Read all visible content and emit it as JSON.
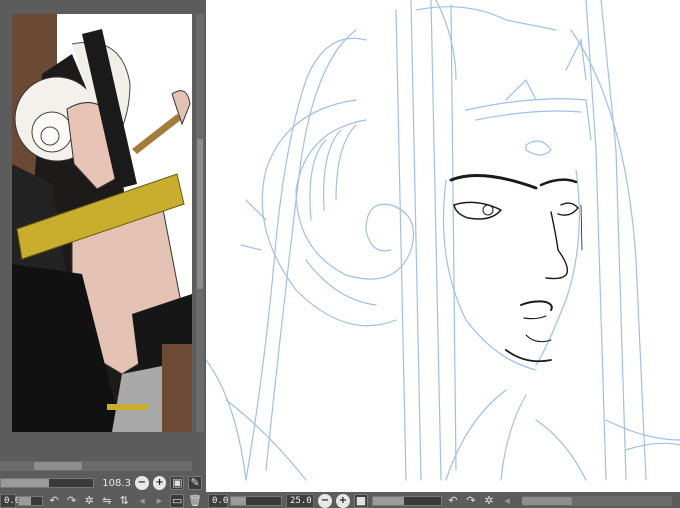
{
  "navigator": {
    "zoom_value": "108.3",
    "rotation_value": "0.0",
    "icons": [
      "zoom-out-icon",
      "zoom-in-icon",
      "fit-icon",
      "pen-icon",
      "rotate-left-icon",
      "rotate-right-icon",
      "reset-rotation-icon",
      "flip-horizontal-icon",
      "flip-vertical-icon"
    ]
  },
  "canvas_toolbar": {
    "rotation_value": "0.0",
    "zoom_value": "25.0",
    "icons": [
      "zoom-out-icon",
      "zoom-in-icon",
      "fit-icon",
      "rotate-left-icon",
      "rotate-right-icon",
      "reset-rotation-icon",
      "scroll-left-icon"
    ]
  },
  "colors": {
    "sketch_blue": "#9ec0ea",
    "ink": "#1a1a1a",
    "panel": "#5c5c5c"
  }
}
